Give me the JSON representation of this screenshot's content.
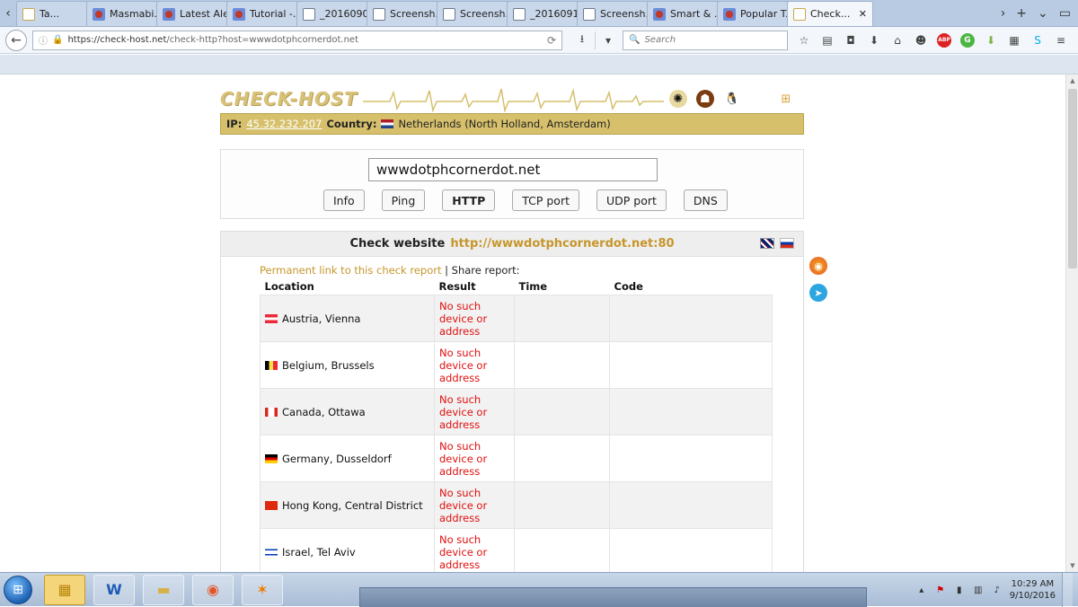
{
  "browser": {
    "tabs": [
      {
        "label": "Ta...",
        "icon": "check-host-favicon"
      },
      {
        "label": "Masmabi...",
        "icon": "site-favicon"
      },
      {
        "label": "Latest Ale...",
        "icon": "site-favicon"
      },
      {
        "label": "Tutorial -...",
        "icon": "site-favicon"
      },
      {
        "label": "_2016090...",
        "icon": "document-favicon"
      },
      {
        "label": "Screensh...",
        "icon": "document-favicon"
      },
      {
        "label": "Screensh...",
        "icon": "document-favicon"
      },
      {
        "label": "_2016091...",
        "icon": "document-favicon"
      },
      {
        "label": "Screensh...",
        "icon": "document-favicon"
      },
      {
        "label": "Smart & ...",
        "icon": "site-favicon"
      },
      {
        "label": "Popular T...",
        "icon": "site-favicon"
      },
      {
        "label": "Check...",
        "icon": "check-host-favicon",
        "active": true
      }
    ],
    "url_host": "https://check-host.net",
    "url_path": "/check-http?host=wwwdotphcornerdot.net",
    "search_placeholder": "Search"
  },
  "site": {
    "logo": "CHECK-HOST",
    "ip_label": "IP:",
    "ip": "45.32.232.207",
    "country_label": "Country:",
    "country": "Netherlands (North Holland, Amsterdam)",
    "host_input": "wwwdotphcornerdot.net",
    "buttons": [
      {
        "label": "Info"
      },
      {
        "label": "Ping"
      },
      {
        "label": "HTTP",
        "active": true
      },
      {
        "label": "TCP port"
      },
      {
        "label": "UDP port"
      },
      {
        "label": "DNS"
      }
    ],
    "check_title": "Check website",
    "check_url": "http://wwwdotphcornerdot.net:80",
    "permalink_text": "Permanent link to this check report",
    "share_text": "| Share report:",
    "columns": [
      "Location",
      "Result",
      "Time",
      "Code"
    ],
    "rows": [
      {
        "flag": "at",
        "location": "Austria, Vienna",
        "result": "No such device or address",
        "time": "",
        "code": ""
      },
      {
        "flag": "be",
        "location": "Belgium, Brussels",
        "result": "No such device or address",
        "time": "",
        "code": ""
      },
      {
        "flag": "ca",
        "location": "Canada, Ottawa",
        "result": "No such device or address",
        "time": "",
        "code": ""
      },
      {
        "flag": "de",
        "location": "Germany, Dusseldorf",
        "result": "No such device or address",
        "time": "",
        "code": ""
      },
      {
        "flag": "hk",
        "location": "Hong Kong, Central District",
        "result": "No such device or address",
        "time": "",
        "code": ""
      },
      {
        "flag": "il",
        "location": "Israel, Tel Aviv",
        "result": "No such device or address",
        "time": "",
        "code": ""
      }
    ]
  },
  "taskbar": {
    "time": "10:29 AM",
    "date": "9/10/2016"
  },
  "colors": {
    "accent_gold": "#d6c06c",
    "link_gold": "#c6962b",
    "error_red": "#e01010"
  }
}
